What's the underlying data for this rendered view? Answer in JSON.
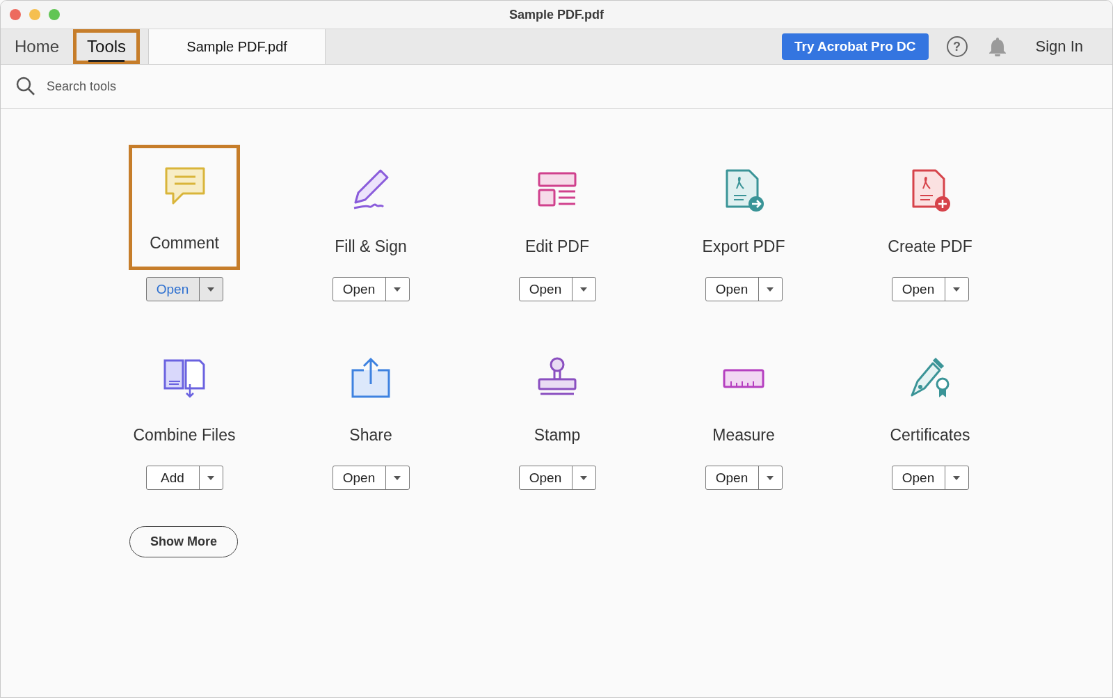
{
  "window": {
    "title": "Sample PDF.pdf"
  },
  "tabs": [
    {
      "label": "Home",
      "selected": false,
      "highlighted": false
    },
    {
      "label": "Tools",
      "selected": true,
      "highlighted": true
    },
    {
      "label": "Sample PDF.pdf",
      "selected": false,
      "highlighted": false
    }
  ],
  "toolbar": {
    "try_button": "Try Acrobat Pro DC",
    "help": "?",
    "sign_in": "Sign In"
  },
  "search": {
    "placeholder": "Search tools"
  },
  "tools": [
    {
      "label": "Comment",
      "button": "Open",
      "selected": true,
      "highlighted": true
    },
    {
      "label": "Fill & Sign",
      "button": "Open",
      "selected": false,
      "highlighted": false
    },
    {
      "label": "Edit PDF",
      "button": "Open",
      "selected": false,
      "highlighted": false
    },
    {
      "label": "Export PDF",
      "button": "Open",
      "selected": false,
      "highlighted": false
    },
    {
      "label": "Create PDF",
      "button": "Open",
      "selected": false,
      "highlighted": false
    },
    {
      "label": "Combine Files",
      "button": "Add",
      "selected": false,
      "highlighted": false
    },
    {
      "label": "Share",
      "button": "Open",
      "selected": false,
      "highlighted": false
    },
    {
      "label": "Stamp",
      "button": "Open",
      "selected": false,
      "highlighted": false
    },
    {
      "label": "Measure",
      "button": "Open",
      "selected": false,
      "highlighted": false
    },
    {
      "label": "Certificates",
      "button": "Open",
      "selected": false,
      "highlighted": false
    }
  ],
  "show_more": "Show More"
}
